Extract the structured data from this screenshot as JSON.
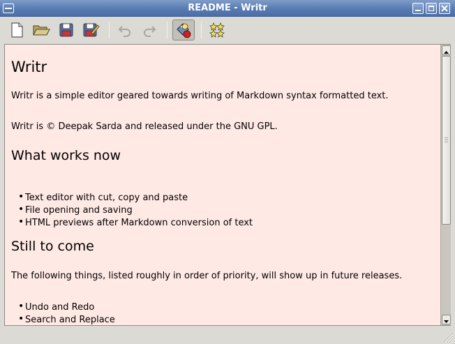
{
  "window": {
    "title": "README - Writr"
  },
  "toolbar": {
    "buttons": [
      {
        "name": "new-document",
        "icon": "new-document-icon",
        "enabled": true
      },
      {
        "name": "open",
        "icon": "folder-open-icon",
        "enabled": true
      },
      {
        "name": "save",
        "icon": "save-icon",
        "enabled": true
      },
      {
        "name": "save-as",
        "icon": "save-as-icon",
        "enabled": true
      },
      {
        "name": "undo",
        "icon": "undo-icon",
        "enabled": false
      },
      {
        "name": "redo",
        "icon": "redo-icon",
        "enabled": false
      },
      {
        "name": "preview-toggle",
        "icon": "preview-icon",
        "enabled": true,
        "pressed": true
      },
      {
        "name": "markdown",
        "icon": "stars-icon",
        "enabled": true
      }
    ]
  },
  "document": {
    "heading1": "Writr",
    "intro": "Writr is a simple editor geared towards writing of Markdown syntax formatted text.",
    "license": "Writr is © Deepak Sarda and released under the GNU GPL.",
    "section1": {
      "heading": "What works now",
      "items": [
        "Text editor with cut, copy and paste",
        "File opening and saving",
        "HTML previews after Markdown conversion of text"
      ]
    },
    "section2": {
      "heading": "Still to come",
      "intro": "The following things, listed roughly in order of priority, will show up in future releases.",
      "items": [
        "Undo and Redo",
        "Search and Replace"
      ]
    },
    "background_color": "#ffe9e5"
  },
  "colors": {
    "titlebar": "#587bb1",
    "window_bg": "#dcdad5"
  }
}
